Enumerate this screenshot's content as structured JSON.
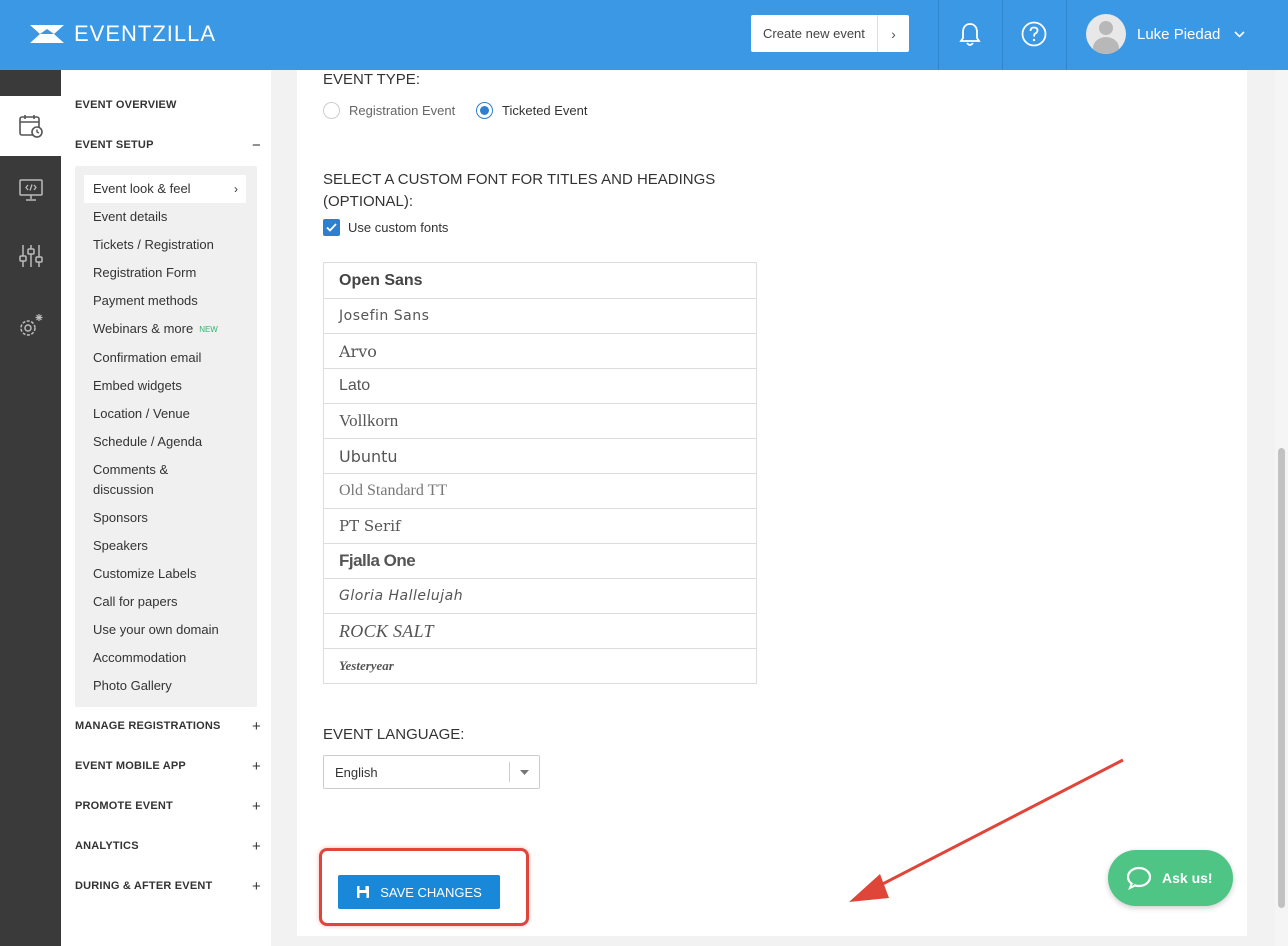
{
  "header": {
    "logo_text": "EVENTZILLA",
    "create_label": "Create new event",
    "create_chevron": "›",
    "bell_icon": "bell-icon",
    "help_icon": "help-icon",
    "user_name": "Luke Piedad",
    "user_chevron": "⌄"
  },
  "rail": {
    "items": [
      "calendar-icon",
      "monitor-code-icon",
      "sliders-icon",
      "gear-sparkle-icon"
    ],
    "active_index": 0
  },
  "sidebar": {
    "sections": [
      {
        "label": "EVENT OVERVIEW",
        "toggle": ""
      },
      {
        "label": "EVENT SETUP",
        "toggle": "−"
      },
      {
        "label": "MANAGE REGISTRATIONS",
        "toggle": "+"
      },
      {
        "label": "EVENT MOBILE APP",
        "toggle": "+"
      },
      {
        "label": "PROMOTE EVENT",
        "toggle": "+"
      },
      {
        "label": "ANALYTICS",
        "toggle": "+"
      },
      {
        "label": "DURING & AFTER EVENT",
        "toggle": "+"
      }
    ],
    "setup_items": [
      {
        "label": "Event look & feel",
        "active": true
      },
      {
        "label": "Event details"
      },
      {
        "label": "Tickets / Registration"
      },
      {
        "label": "Registration Form"
      },
      {
        "label": "Payment methods"
      },
      {
        "label": "Webinars & more",
        "badge": "NEW"
      },
      {
        "label": "Confirmation email"
      },
      {
        "label": "Embed widgets"
      },
      {
        "label": "Location / Venue"
      },
      {
        "label": "Schedule / Agenda"
      },
      {
        "label": "Comments &"
      },
      {
        "label": "discussion"
      },
      {
        "label": "Sponsors"
      },
      {
        "label": "Speakers"
      },
      {
        "label": "Customize Labels"
      },
      {
        "label": "Call for papers"
      },
      {
        "label": "Use your own domain"
      },
      {
        "label": "Accommodation"
      },
      {
        "label": "Photo Gallery"
      }
    ],
    "active_chevron": "›"
  },
  "main": {
    "event_type_label": "EVENT TYPE:",
    "radio_registration": "Registration Event",
    "radio_ticketed": "Ticketed Event",
    "selected_type": "Ticketed Event",
    "font_label_line1": "SELECT A CUSTOM FONT FOR TITLES AND HEADINGS",
    "font_label_line2": "(OPTIONAL):",
    "use_custom_fonts": "Use custom fonts",
    "use_custom_fonts_checked": true,
    "fonts": [
      "Open Sans",
      "Josefin Sans",
      "Arvo",
      "Lato",
      "Vollkorn",
      "Ubuntu",
      "Old Standard TT",
      "PT Serif",
      "Fjalla One",
      "Gloria Hallelujah",
      "Rock Salt",
      "Yesteryear"
    ],
    "language_label": "EVENT LANGUAGE:",
    "language_value": "English",
    "save_label": "SAVE CHANGES"
  },
  "chat": {
    "label": "Ask us!"
  },
  "colors": {
    "header": "#3a98e4",
    "rail": "#3a3a3a",
    "primary_button": "#1a88d8",
    "chat": "#4ec485",
    "annotation": "#e0453a"
  }
}
